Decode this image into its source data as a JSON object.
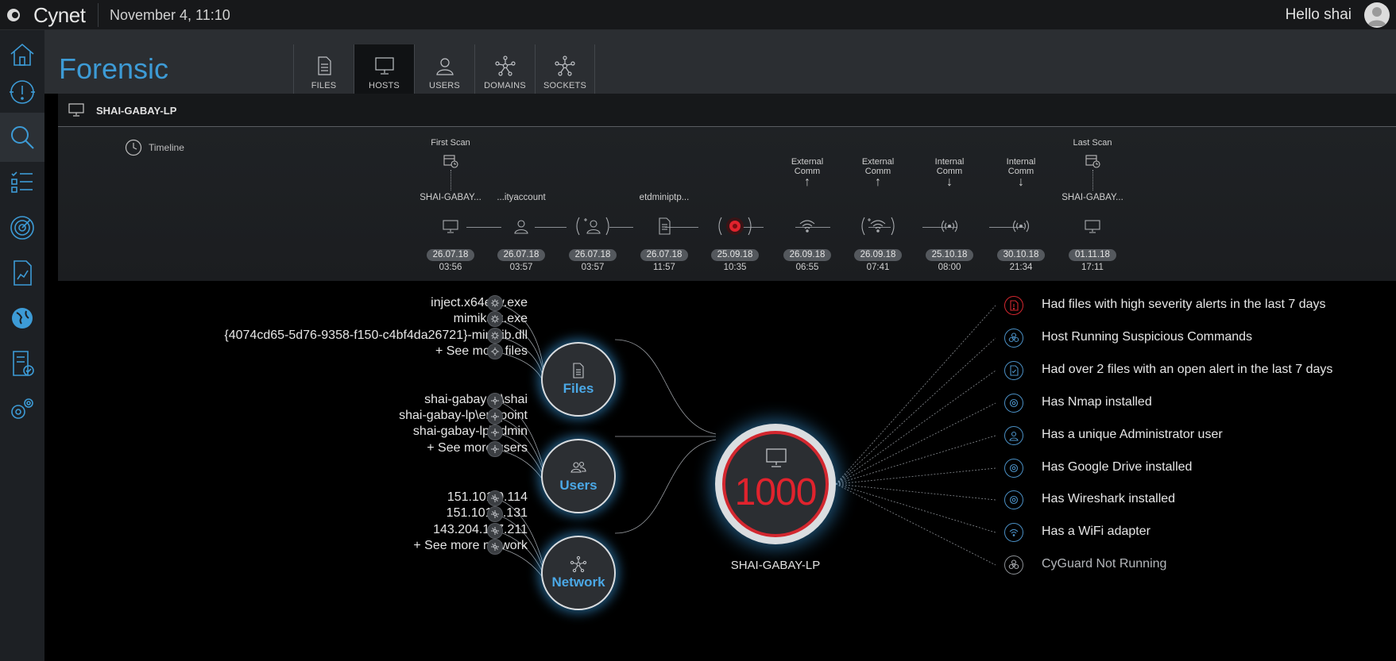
{
  "app": {
    "name": "Cynet",
    "datetime": "November 4, 11:10",
    "greeting": "Hello shai"
  },
  "sidebar": {
    "items": [
      {
        "icon": "home-icon"
      },
      {
        "icon": "alert-icon"
      },
      {
        "icon": "search-icon",
        "active": true
      },
      {
        "icon": "list-icon"
      },
      {
        "icon": "radar-icon"
      },
      {
        "icon": "report-icon"
      },
      {
        "icon": "globe-icon"
      },
      {
        "icon": "checklist-icon"
      },
      {
        "icon": "settings-icon"
      }
    ]
  },
  "page": {
    "title": "Forensic"
  },
  "tabs": [
    {
      "label": "FILES",
      "icon": "file-icon"
    },
    {
      "label": "HOSTS",
      "icon": "monitor-icon",
      "active": true
    },
    {
      "label": "USERS",
      "icon": "user-icon"
    },
    {
      "label": "DOMAINS",
      "icon": "network-icon"
    },
    {
      "label": "SOCKETS",
      "icon": "network-icon"
    }
  ],
  "host": {
    "name": "SHAI-GABAY-LP",
    "timeline_label": "Timeline"
  },
  "timeline": [
    {
      "top": "First Scan",
      "top_arrow": "",
      "sub": "SHAI-GABAY...",
      "icon": "monitor-icon",
      "date": "26.07.18",
      "time": "03:56"
    },
    {
      "top": "",
      "top_arrow": "",
      "sub": "...ityaccount",
      "icon": "user-icon",
      "date": "26.07.18",
      "time": "03:57"
    },
    {
      "top": "",
      "top_arrow": "",
      "sub": "",
      "icon": "new-user-icon",
      "date": "26.07.18",
      "time": "03:57"
    },
    {
      "top": "",
      "top_arrow": "",
      "sub": "etdminiptp...",
      "icon": "file-icon",
      "date": "26.07.18",
      "time": "11:57"
    },
    {
      "top": "",
      "top_arrow": "",
      "sub": "",
      "icon": "virus-icon",
      "date": "25.09.18",
      "time": "10:35"
    },
    {
      "top": "External\nComm",
      "top_arrow": "↑",
      "sub": "",
      "icon": "wifi-icon",
      "date": "26.09.18",
      "time": "06:55"
    },
    {
      "top": "External\nComm",
      "top_arrow": "↑",
      "sub": "",
      "icon": "new-wifi-icon",
      "date": "26.09.18",
      "time": "07:41"
    },
    {
      "top": "Internal\nComm",
      "top_arrow": "↓",
      "sub": "",
      "icon": "broadcast-icon",
      "date": "25.10.18",
      "time": "08:00"
    },
    {
      "top": "Internal\nComm",
      "top_arrow": "↓",
      "sub": "",
      "icon": "broadcast-icon",
      "date": "30.10.18",
      "time": "21:34"
    },
    {
      "top": "Last Scan",
      "top_arrow": "",
      "sub": "SHAI-GABAY...",
      "icon": "monitor-icon",
      "date": "01.11.18",
      "time": "17:11"
    }
  ],
  "graph": {
    "center": {
      "score": "1000",
      "label": "SHAI-GABAY-LP"
    },
    "hubs": [
      {
        "label": "Files",
        "icon": "file-icon",
        "items": [
          "inject.x64etw.exe",
          "mimikatz.exe",
          "{4074cd65-5d76-9358-f150-c4bf4da26721}-mimilib.dll",
          "+ See more files"
        ]
      },
      {
        "label": "Users",
        "icon": "users-icon",
        "items": [
          "shai-gabay-lp\\shai",
          "shai-gabay-lp\\endpoint",
          "shai-gabay-lp\\admin",
          "+ See more users"
        ]
      },
      {
        "label": "Network",
        "icon": "network-icon",
        "items": [
          "151.101.0.114",
          "151.101.1.131",
          "143.204.177.211",
          "+ See more network"
        ]
      }
    ],
    "insights": [
      {
        "text": "Had files with high severity alerts in the last 7 days",
        "icon": "high-alert-file-icon",
        "color": "#d3272f"
      },
      {
        "text": "Host Running Suspicious Commands",
        "icon": "biohazard-icon",
        "color": "#4a8fc4"
      },
      {
        "text": "Had over 2 files with an open alert in the last 7 days",
        "icon": "alert-file-icon",
        "color": "#4a8fc4"
      },
      {
        "text": "Has Nmap installed",
        "icon": "gear-icon",
        "color": "#4a8fc4"
      },
      {
        "text": "Has a unique Administrator user",
        "icon": "admin-user-icon",
        "color": "#4a8fc4"
      },
      {
        "text": "Has Google Drive installed",
        "icon": "gear-icon",
        "color": "#4a8fc4"
      },
      {
        "text": "Has Wireshark installed",
        "icon": "gear-icon",
        "color": "#4a8fc4"
      },
      {
        "text": "Has a WiFi adapter",
        "icon": "wifi-icon",
        "color": "#4a8fc4"
      },
      {
        "text": "CyGuard Not Running",
        "icon": "biohazard-icon",
        "color": "#8a8e93"
      }
    ]
  }
}
